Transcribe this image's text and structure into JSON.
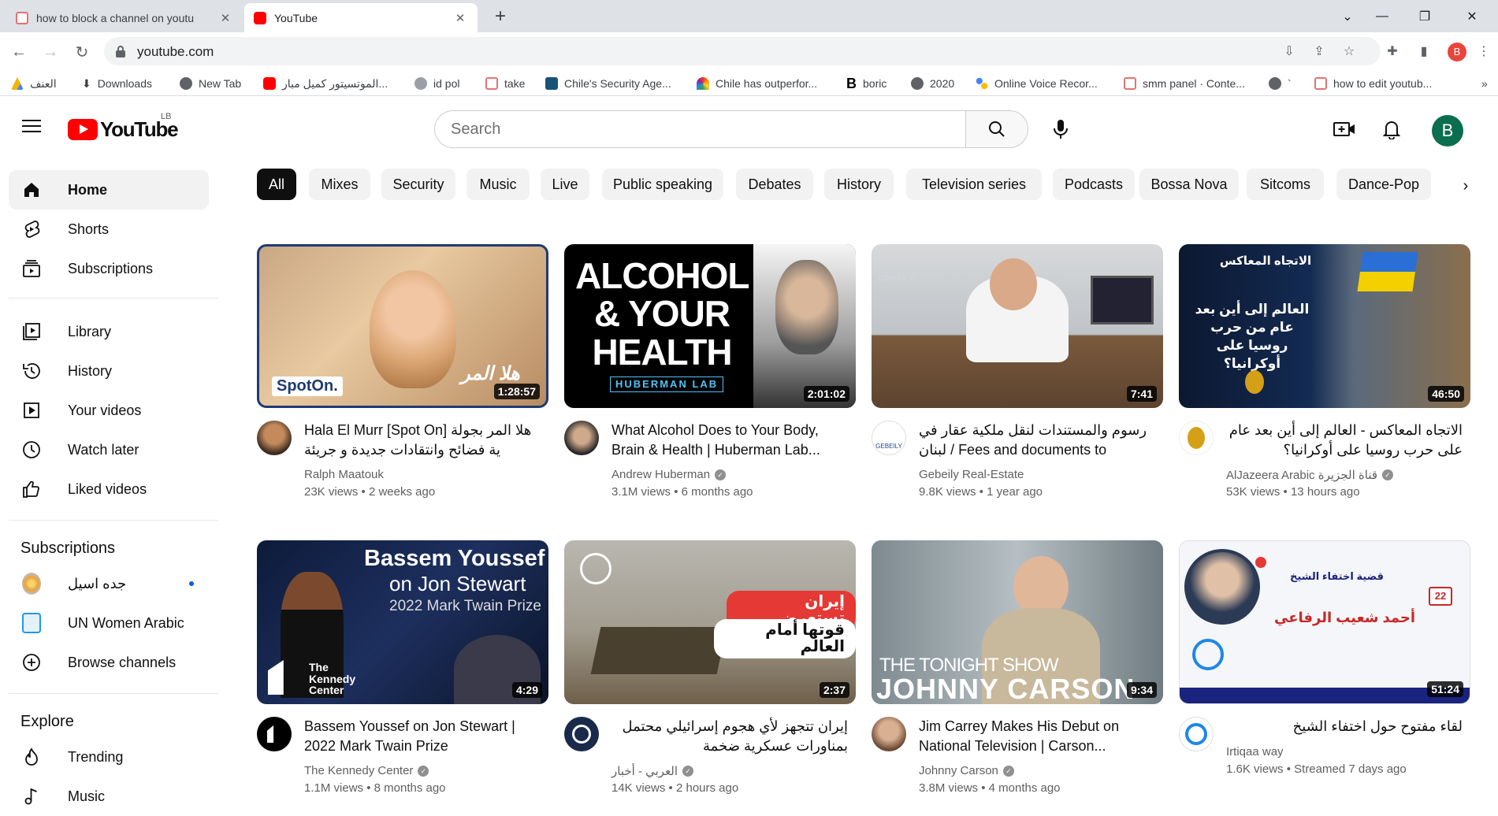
{
  "browser": {
    "tabs": [
      {
        "title": "how to block a channel on youtu"
      },
      {
        "title": "YouTube"
      }
    ],
    "address": "youtube.com",
    "profile_initial": "B",
    "bookmarks": [
      {
        "label": "العنف"
      },
      {
        "label": "Downloads"
      },
      {
        "label": "New Tab"
      },
      {
        "label": "الموتسيتور كميل مبار..."
      },
      {
        "label": "id pol"
      },
      {
        "label": "take"
      },
      {
        "label": "Chile's Security Age..."
      },
      {
        "label": "Chile has outperfor..."
      },
      {
        "label": "boric"
      },
      {
        "label": "2020"
      },
      {
        "label": "Online Voice Recor..."
      },
      {
        "label": "smm panel · Conte..."
      },
      {
        "label": "`"
      },
      {
        "label": "how to edit youtub..."
      }
    ],
    "bookmarks_more": "»"
  },
  "header": {
    "logo_text": "YouTube",
    "country_code": "LB",
    "search_placeholder": "Search",
    "user_initial": "B"
  },
  "sidebar": {
    "main": [
      {
        "label": "Home"
      },
      {
        "label": "Shorts"
      },
      {
        "label": "Subscriptions"
      }
    ],
    "library": [
      {
        "label": "Library"
      },
      {
        "label": "History"
      },
      {
        "label": "Your videos"
      },
      {
        "label": "Watch later"
      },
      {
        "label": "Liked videos"
      }
    ],
    "subscriptions_heading": "Subscriptions",
    "subscriptions": [
      {
        "label": "جده اسيل"
      },
      {
        "label": "UN Women Arabic"
      },
      {
        "label": "Browse channels"
      }
    ],
    "explore_heading": "Explore",
    "explore": [
      {
        "label": "Trending"
      },
      {
        "label": "Music"
      }
    ]
  },
  "chips": [
    "All",
    "Mixes",
    "Security",
    "Music",
    "Live",
    "Public speaking",
    "Debates",
    "History",
    "Television series",
    "Podcasts",
    "Bossa Nova",
    "Sitcoms",
    "Dance-Pop"
  ],
  "videos": [
    {
      "title": "Hala El Murr [Spot On] هلا المر بجولة ية فضائح وانتقادات جديدة و جريئة بالأسماء، مع...",
      "channel": "Ralph Maatouk",
      "verified": false,
      "views": "23K views",
      "age": "2 weeks ago",
      "duration": "1:28:57",
      "thumb_text": "SpotOn.",
      "thumb_text2": "هلا المر"
    },
    {
      "title": "What Alcohol Does to Your Body, Brain & Health | Huberman Lab...",
      "channel": "Andrew Huberman",
      "verified": true,
      "views": "3.1M views",
      "age": "6 months ago",
      "duration": "2:01:02",
      "thumb_text": "ALCOHOL & YOUR HEALTH",
      "thumb_text2": "HUBERMAN LAB"
    },
    {
      "title": "رسوم والمستندات لنقل ملكية عقار في لبنان / Fees and documents to transfer a...",
      "channel": "Gebeily Real-Estate",
      "verified": false,
      "views": "9.8K views",
      "age": "1 year ago",
      "duration": "7:41",
      "thumb_text": "GEBEILY",
      "thumb_text2": ""
    },
    {
      "title": "الاتجاه المعاكس - العالم إلى أين بعد عام على حرب روسيا على أوكرانيا؟",
      "channel": "AlJazeera Arabic قناة الجزيرة",
      "verified": true,
      "views": "53K views",
      "age": "13 hours ago",
      "duration": "46:50",
      "thumb_text": "الاتجاه المعاكس",
      "thumb_text2": "العالم إلى أين بعد عام من حرب روسيا على أوكرانيا؟"
    },
    {
      "title": "Bassem Youssef on Jon Stewart | 2022 Mark Twain Prize",
      "channel": "The Kennedy Center",
      "verified": true,
      "views": "1.1M views",
      "age": "8 months ago",
      "duration": "4:29",
      "thumb_text": "Bassem Youssef",
      "thumb_text2": "on Jon Stewart",
      "thumb_text3": "2022 Mark Twain Prize",
      "thumb_text4": "The Kennedy Center"
    },
    {
      "title": "إيران تتجهز لأي هجوم إسرائيلي محتمل بمناورات عسكرية ضخمة",
      "channel": "العربي - أخبار",
      "verified": true,
      "views": "14K views",
      "age": "2 hours ago",
      "duration": "2:37",
      "thumb_text": "إيران تستعرض",
      "thumb_text2": "قوتها أمام العالم"
    },
    {
      "title": "Jim Carrey Makes His Debut on National Television | Carson...",
      "channel": "Johnny Carson",
      "verified": true,
      "views": "3.8M views",
      "age": "4 months ago",
      "duration": "9:34",
      "thumb_text": "THE TONIGHT SHOW",
      "thumb_text2": "JOHNNY CARSON"
    },
    {
      "title": "لقاء مفتوح حول اختفاء الشيخ",
      "channel": "Irtiqaa way",
      "verified": false,
      "views": "1.6K views",
      "age": "Streamed 7 days ago",
      "duration": "51:24",
      "thumb_text": "أحمد شعيب الرفاعي",
      "thumb_text2": "قضية اختفاء الشيخ"
    }
  ],
  "colors": {
    "yt_red": "#ff0000",
    "chip_active": "#0f0f0f",
    "chip_bg": "#f2f2f2",
    "text_secondary": "#606060"
  }
}
